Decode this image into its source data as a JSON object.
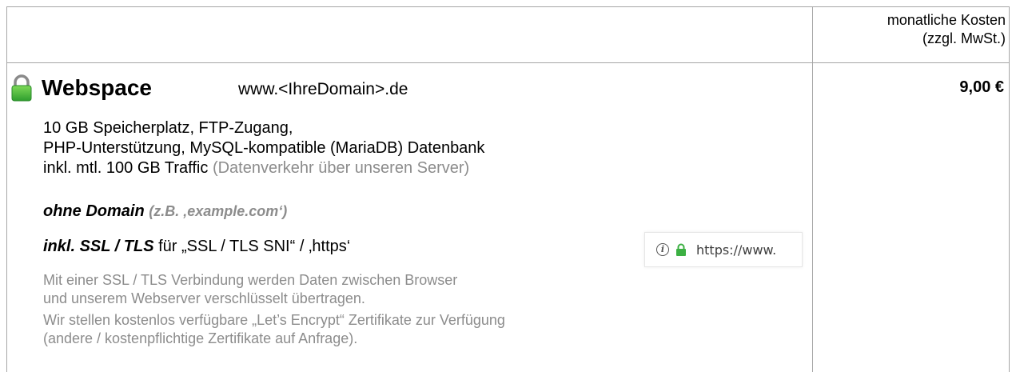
{
  "header": {
    "cost_line1": "monatliche Kosten",
    "cost_line2": "(zzgl. MwSt.)"
  },
  "product": {
    "icon": "lock-icon",
    "title": "Webspace",
    "domain": "www.<IhreDomain>.de",
    "price": "9,00 €"
  },
  "features": {
    "line1": "10 GB  Speicherplatz, FTP-Zugang,",
    "line2": "PHP-Unterstützung, MySQL-kompatible (MariaDB) Datenbank",
    "line3_main": "inkl. mtl. 100 GB Traffic",
    "line3_note": "(Datenverkehr über unseren Server)"
  },
  "domain_note": {
    "main": "ohne Domain",
    "example": "(z.B. ‚example.com‘)"
  },
  "ssl": {
    "bold": "inkl. SSL / TLS",
    "rest": "für „SSL / TLS SNI“ / ‚https‘"
  },
  "description": {
    "p1_line1": "Mit einer SSL / TLS  Verbindung werden Daten zwischen Browser",
    "p1_line2": "und unserem Webserver verschlüsselt übertragen.",
    "p2_line1": "Wir stellen kostenlos verfügbare „Let’s Encrypt“ Zertifikate zur Verfügung",
    "p2_line2": "(andere / kostenpflichtige Zertifikate auf Anfrage)."
  },
  "browser_bar": {
    "info_glyph": "i",
    "url": "https://www."
  },
  "colors": {
    "border": "#a6a6a6",
    "muted_text": "#8c8c8c",
    "lock_green": "#3cb043"
  }
}
